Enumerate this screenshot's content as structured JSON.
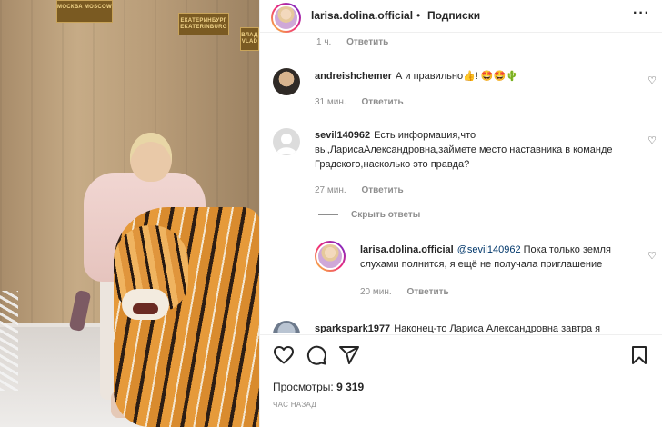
{
  "photo": {
    "signs": {
      "moscow": "МОСКВА MOSCOW",
      "ekaterinburg": "ЕКАТЕРИНБУРГ EKATERINBURG",
      "vladivostok": "ВЛАД VLAD"
    }
  },
  "header": {
    "username": "larisa.dolina.official",
    "separator": "•",
    "follow_label": "Подписки",
    "more_icon": "more-horizontal-icon"
  },
  "comments": {
    "top_meta": {
      "time": "1 ч.",
      "reply": "Ответить"
    },
    "items": [
      {
        "user": "andreishchemer",
        "text": "А и правильно👍! 🤩🤩🌵",
        "time": "31 мин.",
        "reply": "Ответить"
      },
      {
        "user": "sevil140962",
        "text": "Есть информация,что вы,ЛарисаАлександровна,займете место наставника в команде Градского,насколько это правда?",
        "time": "27 мин.",
        "reply": "Ответить"
      }
    ],
    "hide_replies": "Скрыть ответы",
    "reply_item": {
      "user": "larisa.dolina.official",
      "mention": "@sevil140962",
      "text": " Пока только земля слухами полнится, я ещё не получала приглашение",
      "time": "20 мин.",
      "reply": "Ответить"
    },
    "partial_item": {
      "user": "sparkspark1977",
      "text": "Наконец-то Лариса Александровна завтра я"
    }
  },
  "actions": {
    "icons": [
      "heart-icon",
      "comment-icon",
      "share-icon",
      "bookmark-icon"
    ],
    "views_label": "Просмотры:",
    "views_count": "9 319",
    "time_ago": "ЧАС НАЗАД"
  }
}
